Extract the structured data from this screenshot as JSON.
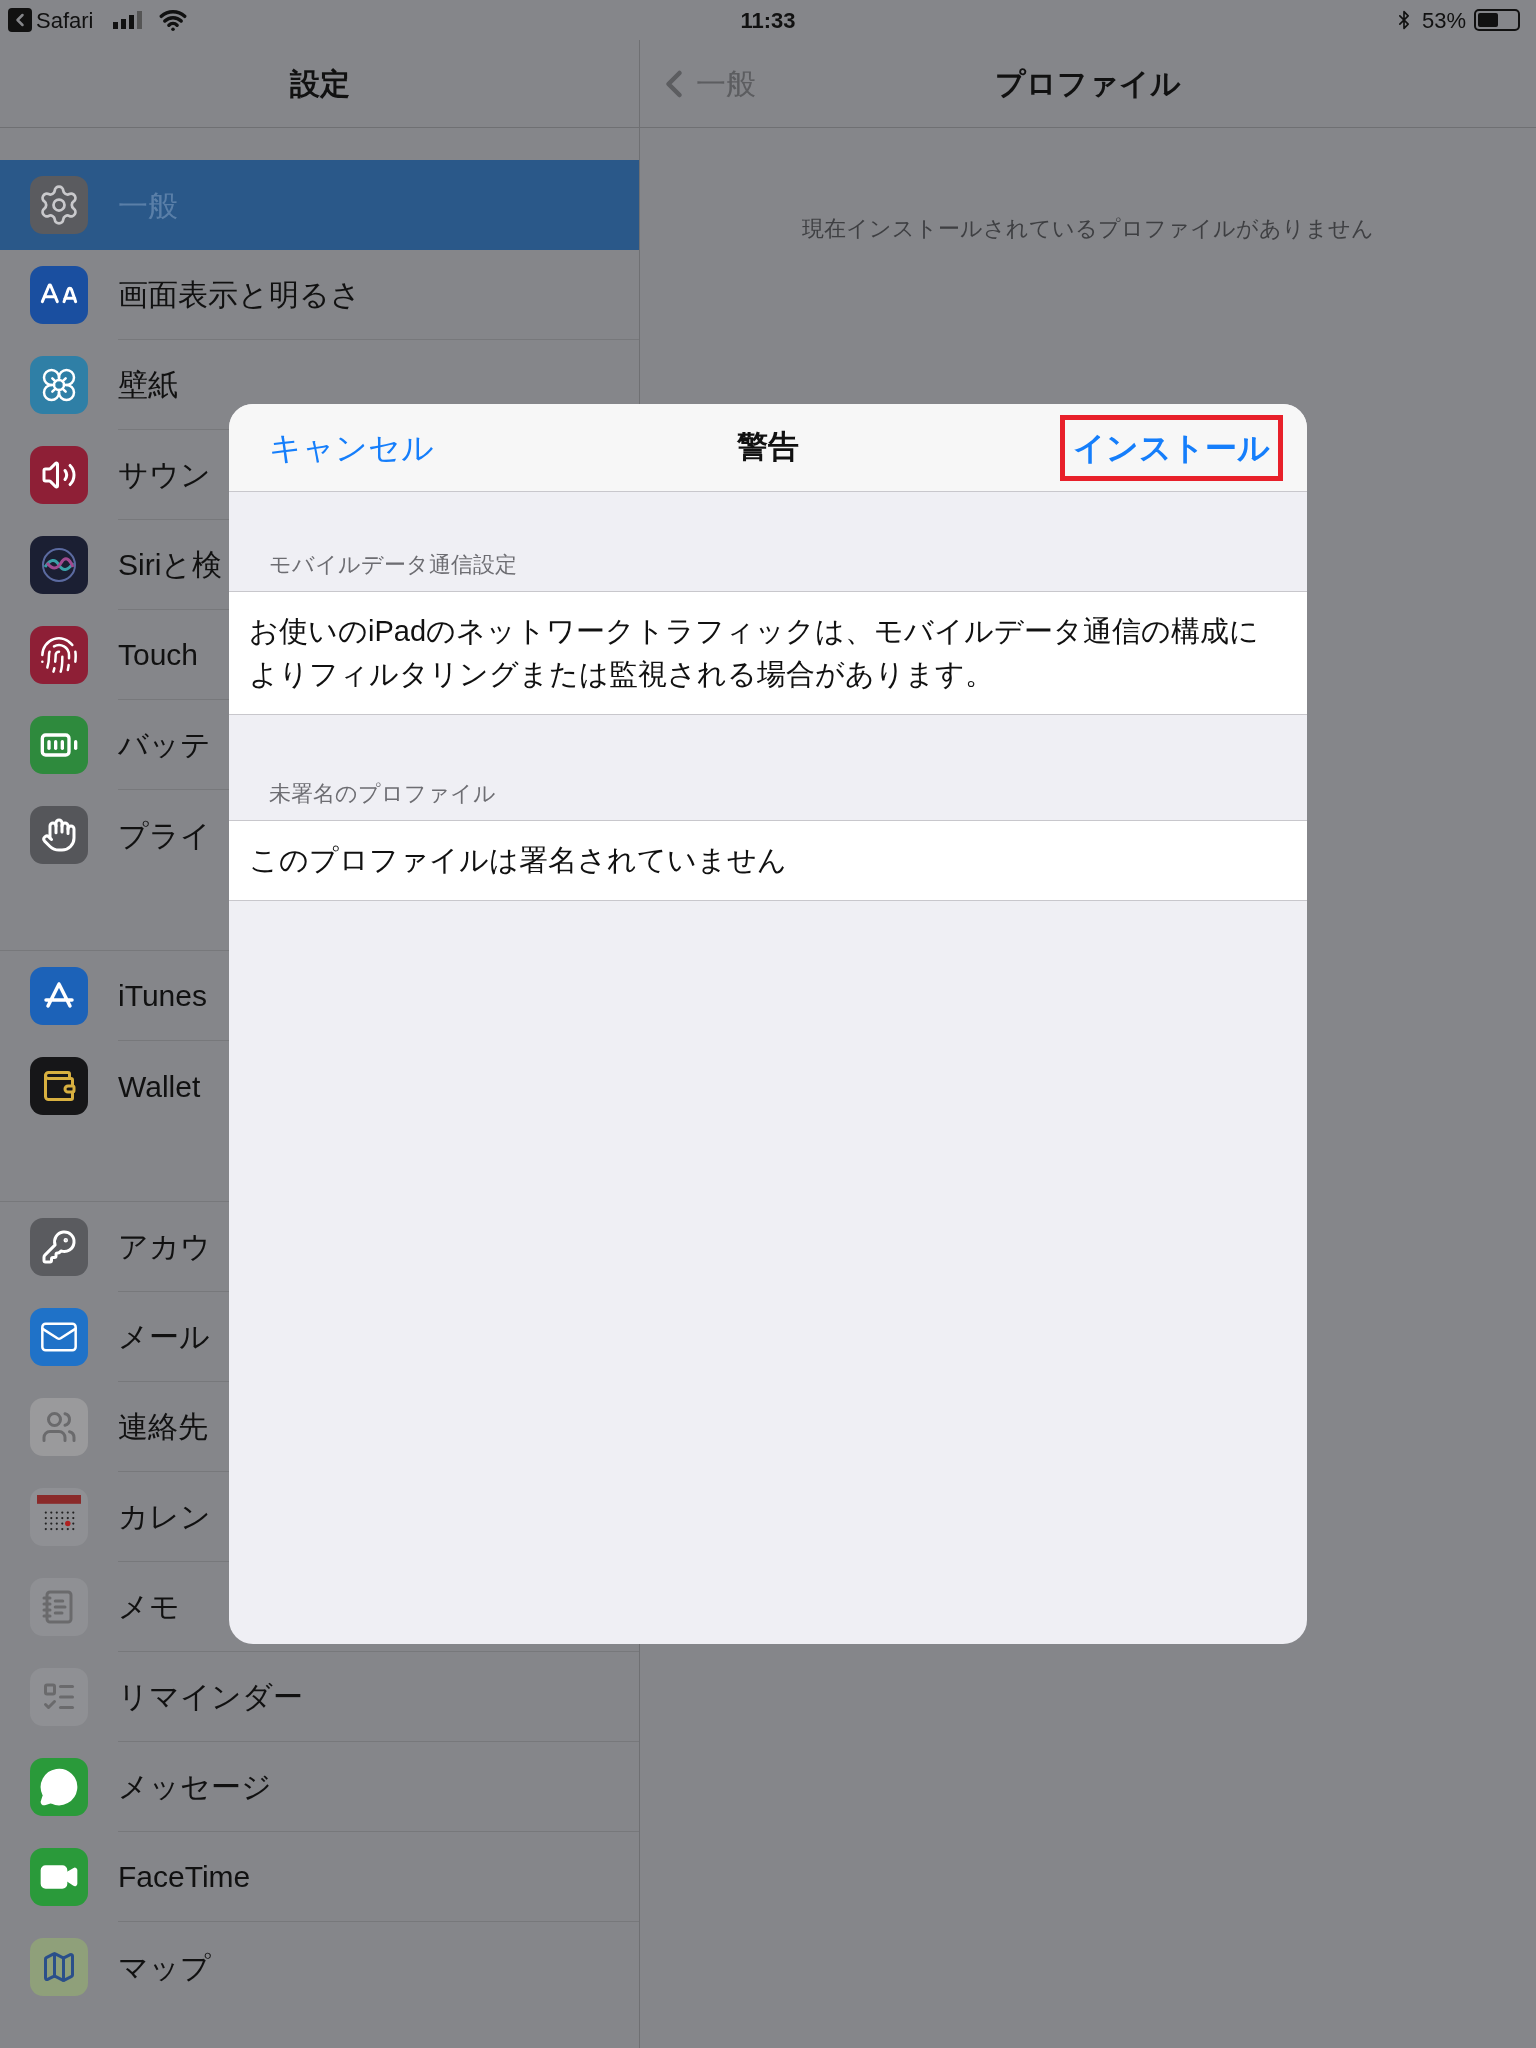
{
  "status_bar": {
    "back_app": "Safari",
    "time": "11:33",
    "battery_percent": "53%"
  },
  "sidebar": {
    "title": "設定",
    "groups": [
      {
        "items": [
          {
            "label": "一般",
            "selected": true,
            "color": "#5a5b5f"
          },
          {
            "label": "画面表示と明るさ",
            "selected": false,
            "color": "#1a4fa0"
          },
          {
            "label": "壁紙",
            "selected": false,
            "color": "#2f7fa6"
          },
          {
            "label": "サウン",
            "selected": false,
            "color": "#8e1f36"
          },
          {
            "label": "Siriと検",
            "selected": false,
            "color": "#1b1f33"
          },
          {
            "label": "Touch",
            "selected": false,
            "color": "#8e1f36"
          },
          {
            "label": "バッテ",
            "selected": false,
            "color": "#2e8a3d"
          },
          {
            "label": "プライ",
            "selected": false,
            "color": "#55565a"
          }
        ]
      },
      {
        "items": [
          {
            "label": "iTunes",
            "selected": false,
            "color": "#1c62b8"
          },
          {
            "label": "Wallet",
            "selected": false,
            "color": "#161618"
          }
        ]
      },
      {
        "items": [
          {
            "label": "アカウ",
            "selected": false,
            "color": "#5a5b5f"
          },
          {
            "label": "メール",
            "selected": false,
            "color": "#1f72c8"
          },
          {
            "label": "連絡先",
            "selected": false,
            "color": "#9a9a9c"
          },
          {
            "label": "カレン",
            "selected": false,
            "color": "#8f9094"
          },
          {
            "label": "メモ",
            "selected": false,
            "color": "#8f9094"
          },
          {
            "label": "リマインダー",
            "selected": false,
            "color": "#8f9094"
          },
          {
            "label": "メッセージ",
            "selected": false,
            "color": "#2a9a3a"
          },
          {
            "label": "FaceTime",
            "selected": false,
            "color": "#2a9a3a"
          },
          {
            "label": "マップ",
            "selected": false,
            "color": "#8fa07a"
          }
        ]
      }
    ]
  },
  "detail": {
    "back_label": "一般",
    "title": "プロファイル",
    "empty_message": "現在インストールされているプロファイルがありません"
  },
  "dialog": {
    "title": "警告",
    "cancel": "キャンセル",
    "install": {
      "label": "インストール",
      "highlighted": true
    },
    "sections": [
      {
        "header": "モバイルデータ通信設定",
        "text": "お使いのiPadのネットワークトラフィックは、モバイルデータ通信の構成によりフィルタリングまたは監視される場合があります。"
      },
      {
        "header": "未署名のプロファイル",
        "text": "このプロファイルは署名されていません"
      }
    ]
  }
}
